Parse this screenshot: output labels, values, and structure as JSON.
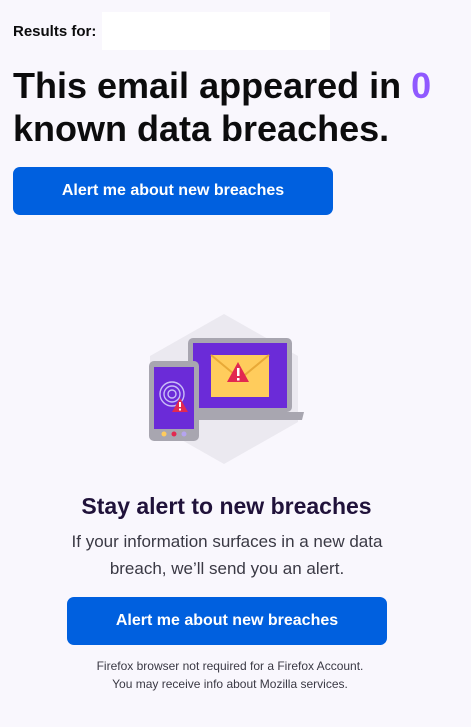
{
  "results": {
    "label": "Results for:",
    "email": ""
  },
  "headline": {
    "before": "This email appeared in ",
    "count": "0",
    "after": " known data breaches."
  },
  "top_button": {
    "label": "Alert me about new breaches"
  },
  "illustration": {
    "icons": [
      "laptop-icon",
      "envelope-icon",
      "warning-icon",
      "tablet-icon",
      "fingerprint-icon"
    ],
    "colors": {
      "purple": "#6b2bd8",
      "frame": "#a8a6b0",
      "envelope": "#ffcc5c",
      "alert": "#e22850",
      "hex_bg": "#ebe9f0"
    }
  },
  "alert_section": {
    "title": "Stay alert to new breaches",
    "text": "If your information surfaces in a new data breach, we’ll send you an alert.",
    "button_label": "Alert me about new breaches",
    "fineprint_1": "Firefox browser not required for a Firefox Account.",
    "fineprint_2": "You may receive info about Mozilla services."
  },
  "colors": {
    "accent": "#0060df",
    "count": "#9059ff",
    "background": "#f9f7fd"
  }
}
